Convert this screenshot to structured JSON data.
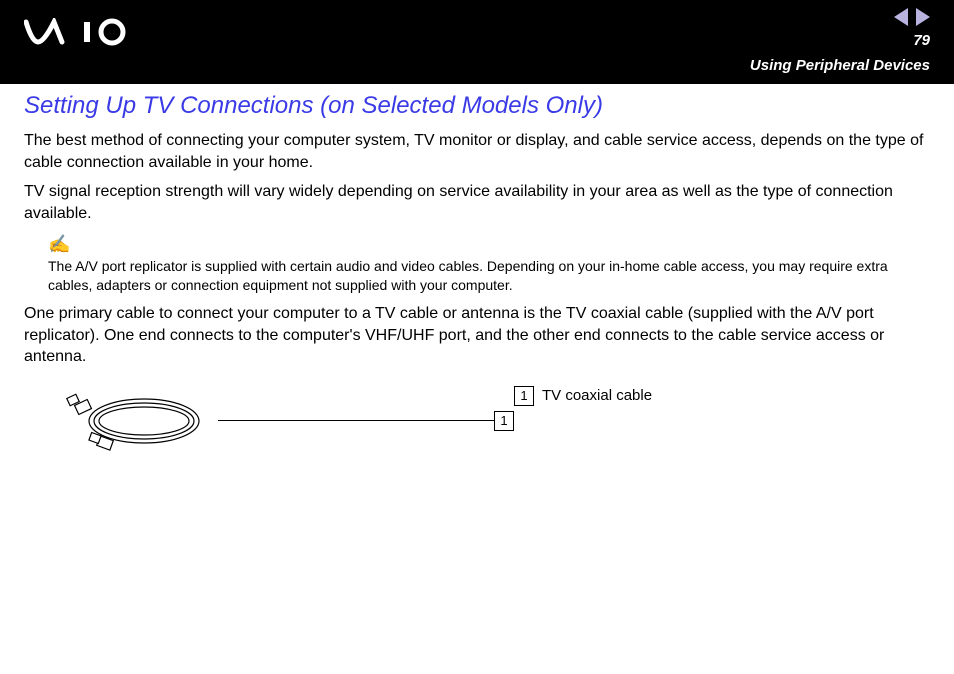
{
  "header": {
    "page_number": "79",
    "section": "Using Peripheral Devices"
  },
  "title": "Setting Up TV Connections (on Selected Models Only)",
  "paragraphs": {
    "p1": "The best method of connecting your computer system, TV monitor or display, and cable service access, depends on the type of cable connection available in your home.",
    "p2": "TV signal reception strength will vary widely depending on service availability in your area as well as the type of connection available.",
    "p3": "One primary cable to connect your computer to a TV cable or antenna is the TV coaxial cable (supplied with the A/V port replicator). One end connects to the computer's VHF/UHF port, and the other end connects to the cable service access or antenna."
  },
  "note": {
    "icon": "✍",
    "text": "The A/V port replicator is supplied with certain audio and video cables. Depending on your in-home cable access, you may require extra cables, adapters or connection equipment not supplied with your computer."
  },
  "figure": {
    "callout_number": "1",
    "legend_number": "1",
    "legend_label": "TV coaxial cable"
  }
}
